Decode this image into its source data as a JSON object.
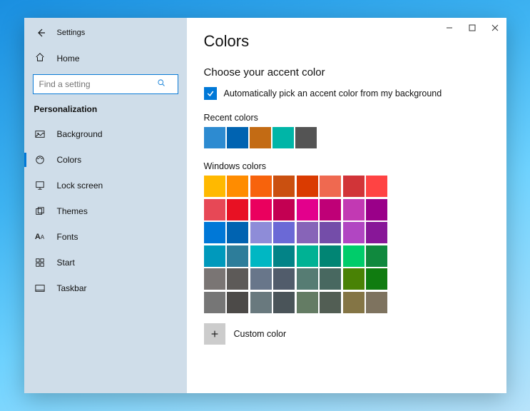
{
  "window": {
    "title": "Settings"
  },
  "sidebar": {
    "home": "Home",
    "search_placeholder": "Find a setting",
    "category": "Personalization",
    "items": [
      {
        "label": "Background"
      },
      {
        "label": "Colors"
      },
      {
        "label": "Lock screen"
      },
      {
        "label": "Themes"
      },
      {
        "label": "Fonts"
      },
      {
        "label": "Start"
      },
      {
        "label": "Taskbar"
      }
    ]
  },
  "main": {
    "title": "Colors",
    "accent_header": "Choose your accent color",
    "auto_pick_label": "Automatically pick an accent color from my background",
    "auto_pick_checked": true,
    "recent_label": "Recent colors",
    "recent_colors": [
      "#2d8bd1",
      "#0063b1",
      "#c36b14",
      "#00b5a7",
      "#545454"
    ],
    "windows_label": "Windows colors",
    "windows_colors": [
      "#ffb900",
      "#ff8c00",
      "#f7630c",
      "#ca5010",
      "#da3b01",
      "#ef6950",
      "#d13438",
      "#ff4343",
      "#e74856",
      "#e81123",
      "#ea005e",
      "#c30052",
      "#e3008c",
      "#bf0077",
      "#c239b3",
      "#9a0089",
      "#0078d7",
      "#0063b1",
      "#8e8cd8",
      "#6b69d6",
      "#8764b8",
      "#744da9",
      "#b146c2",
      "#881798",
      "#0099bc",
      "#2d7d9a",
      "#00b7c3",
      "#038387",
      "#00b294",
      "#018574",
      "#00cc6a",
      "#10893e",
      "#7a7574",
      "#5d5a58",
      "#68768a",
      "#515c6b",
      "#567c73",
      "#486860",
      "#498205",
      "#107c10",
      "#767676",
      "#4c4a48",
      "#69797e",
      "#4a5459",
      "#647c64",
      "#525e54",
      "#847545",
      "#7e735f"
    ],
    "custom_label": "Custom color"
  }
}
